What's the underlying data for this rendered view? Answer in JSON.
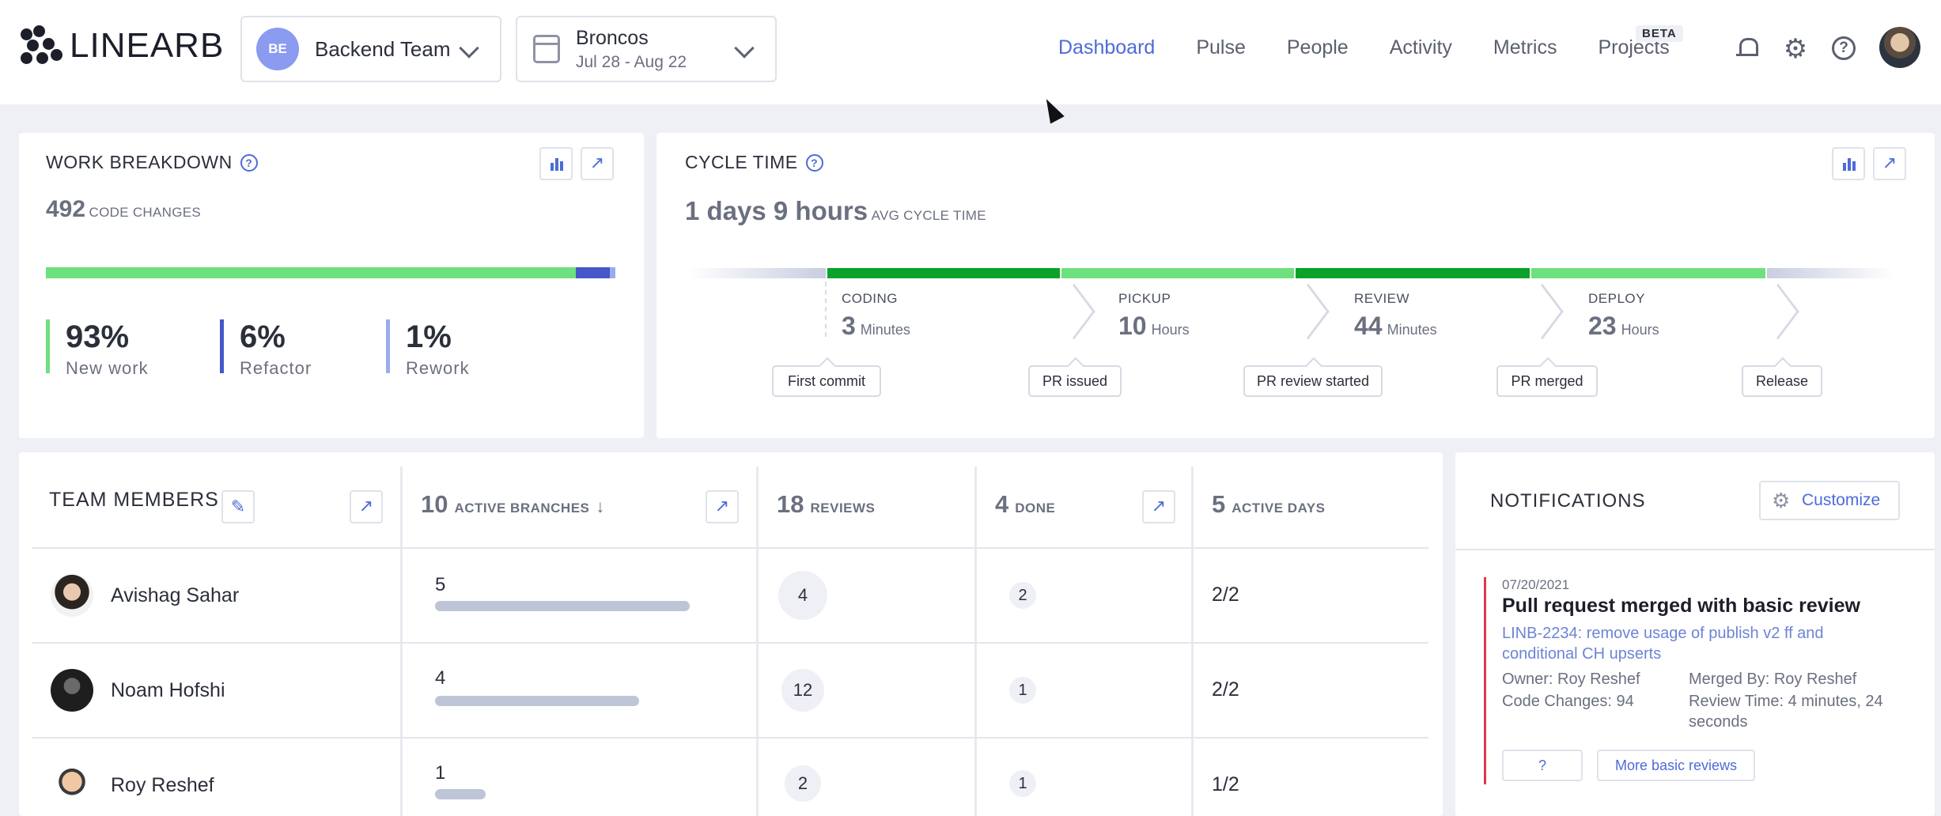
{
  "brand": {
    "logo_text": "LINEARB"
  },
  "team_selector": {
    "badge": "BE",
    "name": "Backend Team"
  },
  "date_selector": {
    "title": "Broncos",
    "range": "Jul 28 - Aug 22"
  },
  "nav": {
    "items": [
      "Dashboard",
      "Pulse",
      "People",
      "Activity",
      "Metrics",
      "Projects"
    ],
    "active": "Dashboard",
    "beta_badge": "BETA"
  },
  "icons": {
    "notifications": "bell-icon",
    "settings": "gear-icon",
    "help": "help-icon",
    "profile": "user-avatar"
  },
  "colors": {
    "accent": "#4d6bd8",
    "new_work": "#6fe07e",
    "refactor": "#4458c9",
    "rework": "#9aabf0",
    "cycle_dark": "#0aa22a",
    "cycle_light": "#6fe07e",
    "notif_marker": "#e0384a"
  },
  "work_breakdown": {
    "title": "WORK BREAKDOWN",
    "total": "492",
    "total_label": "CODE CHANGES",
    "shares": [
      0.93,
      0.06,
      0.01
    ],
    "stats": [
      {
        "value": "93%",
        "label": "New work"
      },
      {
        "value": "6%",
        "label": "Refactor"
      },
      {
        "value": "1%",
        "label": "Rework"
      }
    ]
  },
  "cycle_time": {
    "title": "CYCLE TIME",
    "avg_value": "1 days 9 hours",
    "avg_label": "AVG CYCLE TIME",
    "phases": [
      {
        "label": "CODING",
        "value": "3",
        "unit": "Minutes"
      },
      {
        "label": "PICKUP",
        "value": "10",
        "unit": "Hours"
      },
      {
        "label": "REVIEW",
        "value": "44",
        "unit": "Minutes"
      },
      {
        "label": "DEPLOY",
        "value": "23",
        "unit": "Hours"
      }
    ],
    "milestones": [
      "First commit",
      "PR issued",
      "PR review started",
      "PR merged",
      "Release"
    ]
  },
  "team_members": {
    "title": "TEAM MEMBERS",
    "columns": {
      "branches": {
        "count": "10",
        "label": "ACTIVE BRANCHES"
      },
      "reviews": {
        "count": "18",
        "label": "REVIEWS"
      },
      "done": {
        "count": "4",
        "label": "DONE"
      },
      "days": {
        "count": "5",
        "label": "ACTIVE DAYS"
      }
    },
    "rows": [
      {
        "name": "Avishag Sahar",
        "branches": "5",
        "branch_share": 1.0,
        "reviews": "4",
        "done": "2",
        "days": "2/2"
      },
      {
        "name": "Noam Hofshi",
        "branches": "4",
        "branch_share": 0.8,
        "reviews": "12",
        "done": "1",
        "days": "2/2"
      },
      {
        "name": "Roy Reshef",
        "branches": "1",
        "branch_share": 0.2,
        "reviews": "2",
        "done": "1",
        "days": "1/2"
      }
    ]
  },
  "notifications": {
    "title": "NOTIFICATIONS",
    "customize_label": "Customize",
    "item": {
      "date": "07/20/2021",
      "heading": "Pull request merged with basic review",
      "link": "LINB-2234: remove usage of publish v2 ff and conditional CH upserts",
      "owner": "Owner: Roy Reshef",
      "code_changes": "Code Changes: 94",
      "merged_by": "Merged By: Roy Reshef",
      "review_time": "Review Time: 4 minutes, 24 seconds",
      "btn_question": "?",
      "btn_more": "More basic reviews"
    }
  }
}
